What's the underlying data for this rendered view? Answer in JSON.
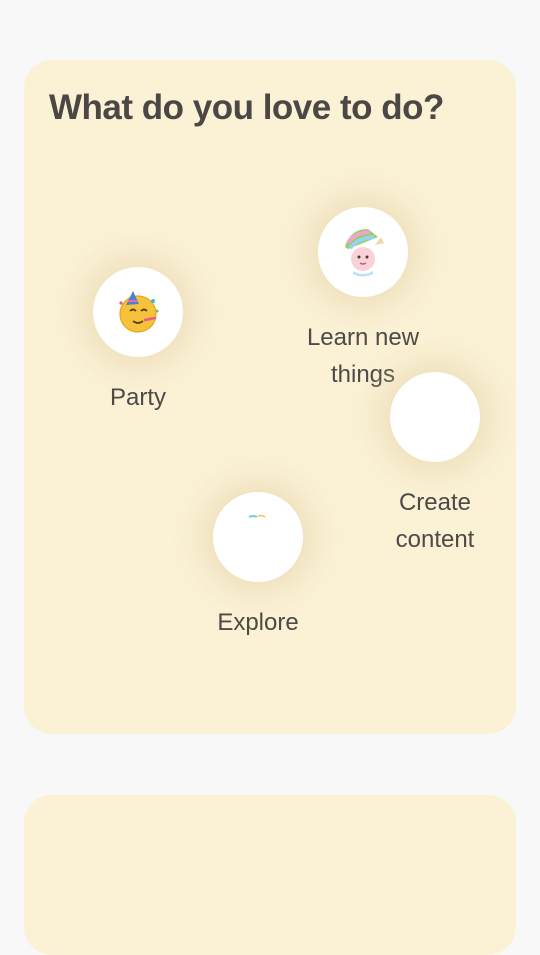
{
  "question": {
    "title": "What do you love to do?"
  },
  "options": [
    {
      "label": "Party",
      "icon": "party-face-icon"
    },
    {
      "label_line1": "Learn new",
      "label_line2": "things",
      "icon": "learner-character-icon"
    },
    {
      "label_line1": "Create",
      "label_line2": "content",
      "icon": "create-content-icon"
    },
    {
      "label": "Explore",
      "icon": "explore-icon"
    }
  ],
  "colors": {
    "card_bg": "#fbf1d5",
    "page_bg": "#f8f8f8",
    "text": "#4b4744"
  }
}
